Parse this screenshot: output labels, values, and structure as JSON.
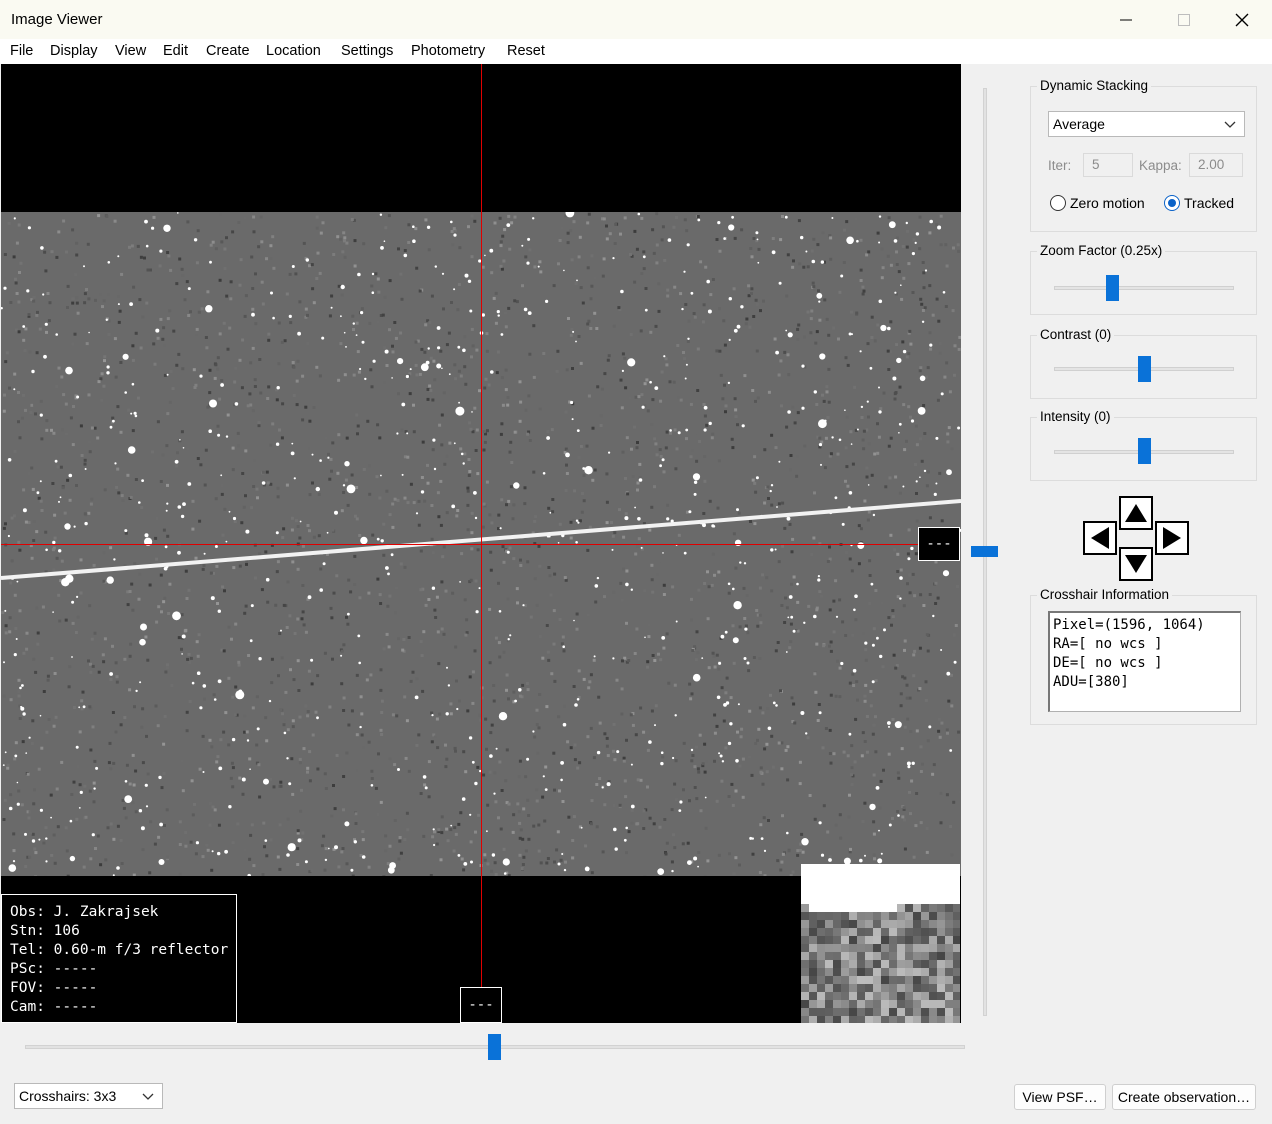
{
  "window": {
    "title": "Image Viewer",
    "minimize_icon": "minimize-icon",
    "maximize_icon": "maximize-icon",
    "close_icon": "close-icon"
  },
  "menu": [
    "File",
    "Display",
    "View",
    "Edit",
    "Create",
    "Location",
    "Settings",
    "Photometry",
    "Reset"
  ],
  "viewer": {
    "info_overlay": {
      "lines": [
        "Obs: J. Zakrajsek",
        "Stn: 106",
        "Tel: 0.60-m f/3 reflector",
        "PSc: -----",
        "FOV: -----",
        "Cam: -----"
      ]
    },
    "right_marker": "---",
    "bottom_marker": "---",
    "crosshair_color": "#e00000"
  },
  "dynamic_stacking": {
    "label": "Dynamic Stacking",
    "method": "Average",
    "iter_label": "Iter:",
    "iter_value": "5",
    "kappa_label": "Kappa:",
    "kappa_value": "2.00",
    "zero_motion_label": "Zero motion",
    "tracked_label": "Tracked",
    "selected": "Tracked"
  },
  "zoom": {
    "label": "Zoom Factor (0.25x)",
    "level": 0.31
  },
  "contrast": {
    "label": "Contrast (0)",
    "level": 0.5
  },
  "intensity": {
    "label": "Intensity (0)",
    "level": 0.5
  },
  "pan": {
    "up_icon": "arrow-up-icon",
    "down_icon": "arrow-down-icon",
    "left_icon": "arrow-left-icon",
    "right_icon": "arrow-right-icon"
  },
  "crosshair_info": {
    "label": "Crosshair Information",
    "text": "Pixel=(1596, 1064)\nRA=[ no wcs ]\nDE=[ no wcs ]\nADU=[380]"
  },
  "bottom": {
    "crosshairs_select": "Crosshairs: 3x3",
    "view_psf": "View PSF…",
    "create_observation": "Create observation…"
  },
  "scroll": {
    "vertical_position": 0.5,
    "horizontal_position": 0.5
  },
  "colors": {
    "accent": "#0a72d8",
    "background": "#f0f0f0"
  }
}
